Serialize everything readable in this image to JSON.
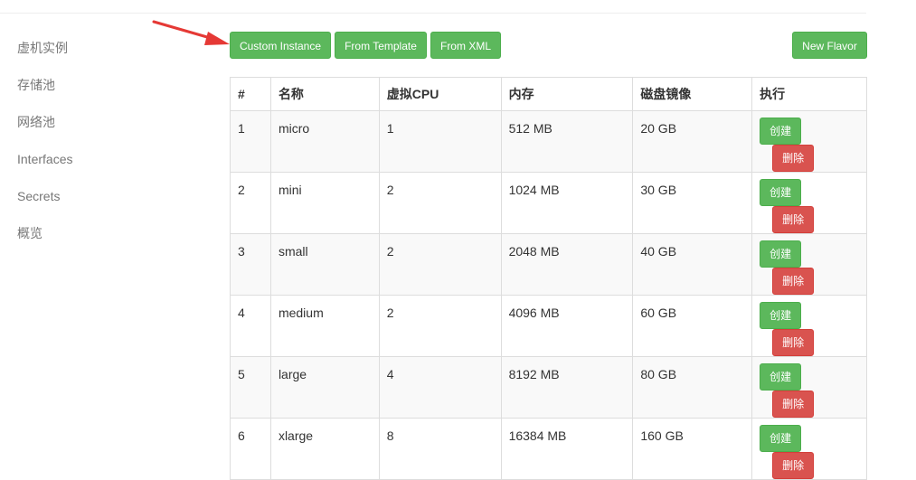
{
  "sidebar": {
    "items": [
      {
        "label": "虚机实例"
      },
      {
        "label": "存储池"
      },
      {
        "label": "网络池"
      },
      {
        "label": "Interfaces"
      },
      {
        "label": "Secrets"
      },
      {
        "label": "概览"
      }
    ]
  },
  "toolbar": {
    "custom_instance": "Custom Instance",
    "from_template": "From Template",
    "from_xml": "From XML",
    "new_flavor": "New Flavor"
  },
  "table": {
    "headers": [
      "#",
      "名称",
      "虚拟CPU",
      "内存",
      "磁盘镜像",
      "执行"
    ],
    "rows": [
      {
        "id": "1",
        "name": "micro",
        "vcpu": "1",
        "memory": "512 MB",
        "disk": "20 GB",
        "create": "创建",
        "delete": "删除"
      },
      {
        "id": "2",
        "name": "mini",
        "vcpu": "2",
        "memory": "1024 MB",
        "disk": "30 GB",
        "create": "创建",
        "delete": "删除"
      },
      {
        "id": "3",
        "name": "small",
        "vcpu": "2",
        "memory": "2048 MB",
        "disk": "40 GB",
        "create": "创建",
        "delete": "删除"
      },
      {
        "id": "4",
        "name": "medium",
        "vcpu": "2",
        "memory": "4096 MB",
        "disk": "60 GB",
        "create": "创建",
        "delete": "删除"
      },
      {
        "id": "5",
        "name": "large",
        "vcpu": "4",
        "memory": "8192 MB",
        "disk": "80 GB",
        "create": "创建",
        "delete": "删除"
      },
      {
        "id": "6",
        "name": "xlarge",
        "vcpu": "8",
        "memory": "16384 MB",
        "disk": "160 GB",
        "create": "创建",
        "delete": "删除"
      }
    ]
  },
  "colors": {
    "success": "#5cb85c",
    "danger": "#d9534f",
    "annotation_arrow": "#e53935"
  },
  "icons": {
    "annotation": "red-arrow-icon"
  }
}
